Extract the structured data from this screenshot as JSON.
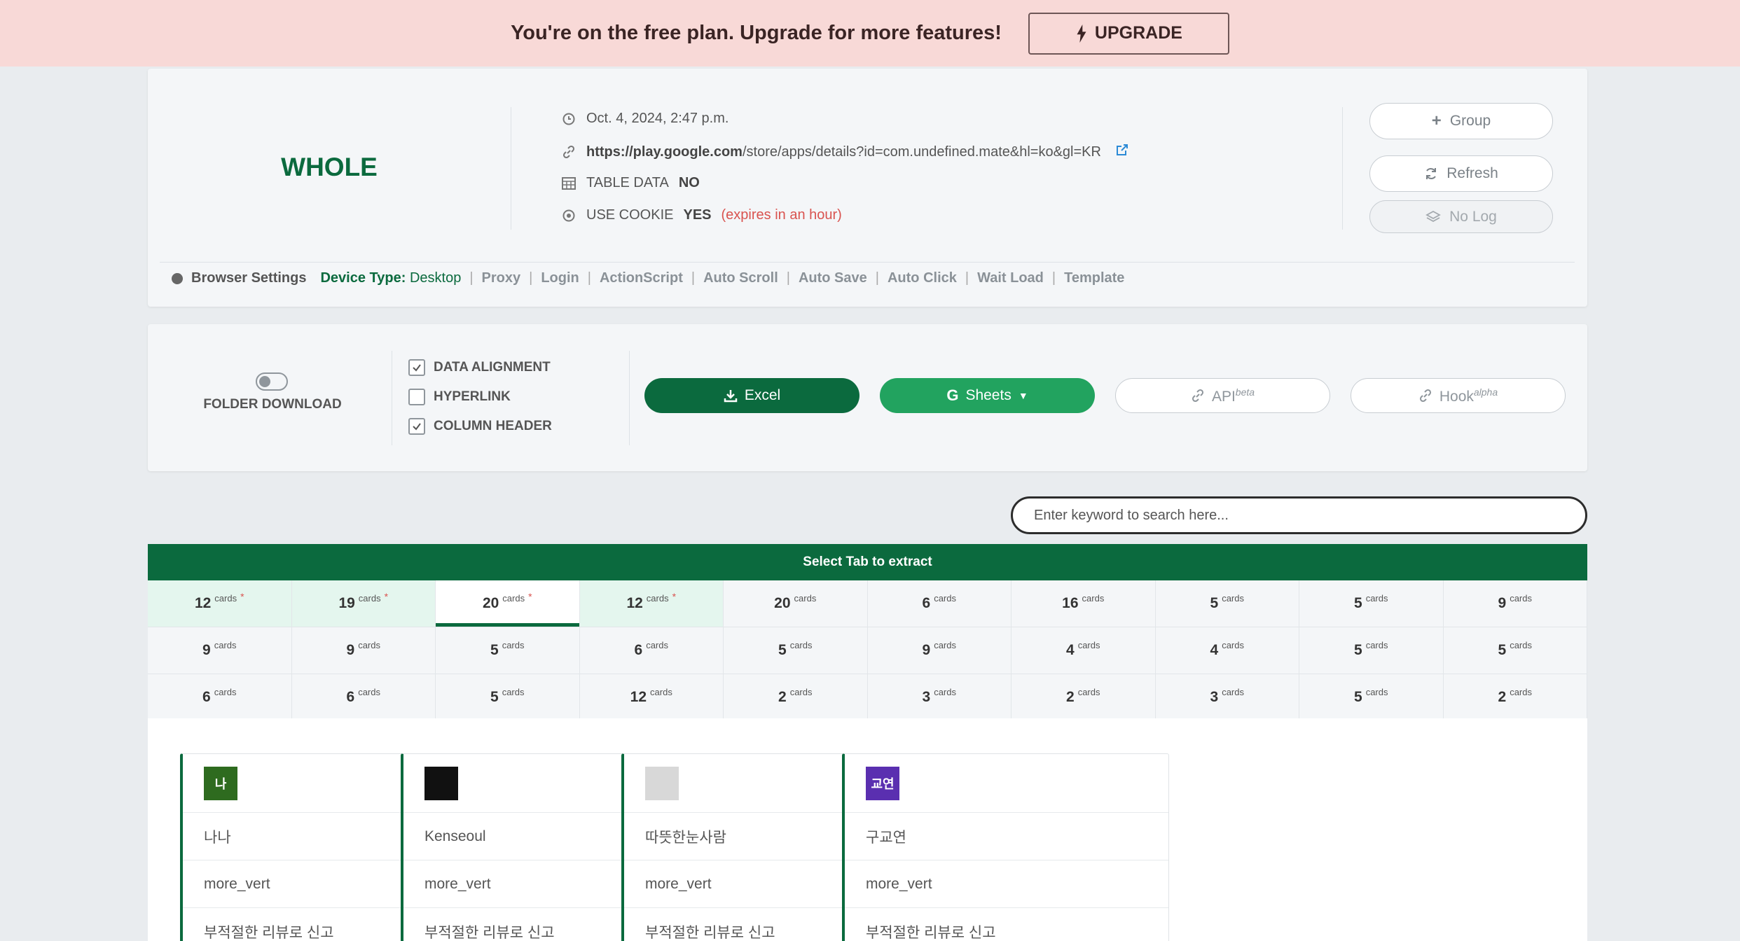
{
  "banner": {
    "text": "You're on the free plan. Upgrade for more features!",
    "button": "UPGRADE"
  },
  "info": {
    "title": "WHOLE",
    "timestamp": "Oct. 4, 2024, 2:47 p.m.",
    "url_host": "https://play.google.com",
    "url_path": "/store/apps/details?id=com.undefined.mate&hl=ko&gl=KR",
    "table_data_label": "TABLE DATA",
    "table_data_value": "NO",
    "use_cookie_label": "USE COOKIE",
    "use_cookie_value": "YES",
    "cookie_expiry": "(expires in an hour)"
  },
  "side_buttons": {
    "group": "Group",
    "refresh": "Refresh",
    "nolog": "No Log"
  },
  "settings": {
    "browser": "Browser Settings",
    "device_label": "Device Type:",
    "device_value": "Desktop",
    "items": [
      "Proxy",
      "Login",
      "ActionScript",
      "Auto Scroll",
      "Auto Save",
      "Auto Click",
      "Wait Load",
      "Template"
    ]
  },
  "export": {
    "folder_download": "FOLDER DOWNLOAD",
    "folder_download_on": false,
    "options": [
      {
        "label": "DATA ALIGNMENT",
        "checked": true
      },
      {
        "label": "HYPERLINK",
        "checked": false
      },
      {
        "label": "COLUMN HEADER",
        "checked": true
      }
    ],
    "excel": "Excel",
    "sheets": "Sheets",
    "api": "API",
    "api_tag": "beta",
    "hook": "Hook",
    "hook_tag": "alpha"
  },
  "search": {
    "placeholder": "Enter keyword to search here..."
  },
  "tabs": {
    "header": "Select Tab to extract",
    "unit": "cards",
    "rows": [
      [
        {
          "n": "12",
          "star": true,
          "hl": true
        },
        {
          "n": "19",
          "star": true,
          "hl": true
        },
        {
          "n": "20",
          "star": true,
          "active": true
        },
        {
          "n": "12",
          "star": true,
          "hl": true
        },
        {
          "n": "20"
        },
        {
          "n": "6"
        },
        {
          "n": "16"
        },
        {
          "n": "5"
        },
        {
          "n": "5"
        },
        {
          "n": "9"
        }
      ],
      [
        {
          "n": "9"
        },
        {
          "n": "9"
        },
        {
          "n": "5"
        },
        {
          "n": "6"
        },
        {
          "n": "5"
        },
        {
          "n": "9"
        },
        {
          "n": "4"
        },
        {
          "n": "4"
        },
        {
          "n": "5"
        },
        {
          "n": "5"
        }
      ],
      [
        {
          "n": "6"
        },
        {
          "n": "6"
        },
        {
          "n": "5"
        },
        {
          "n": "12"
        },
        {
          "n": "2"
        },
        {
          "n": "3"
        },
        {
          "n": "2"
        },
        {
          "n": "3"
        },
        {
          "n": "5"
        },
        {
          "n": "2"
        }
      ]
    ]
  },
  "cards": [
    {
      "avatar_text": "나",
      "avatar_color": "#2e6b1f",
      "name": "나나",
      "menu": "more_vert",
      "report": "부적절한 리뷰로 신고"
    },
    {
      "avatar_text": "",
      "avatar_color": "#111111",
      "name": "Kenseoul",
      "menu": "more_vert",
      "report": "부적절한 리뷰로 신고"
    },
    {
      "avatar_text": "",
      "avatar_color": "#d8d8d8",
      "name": "따뜻한눈사람",
      "menu": "more_vert",
      "report": "부적절한 리뷰로 신고"
    },
    {
      "avatar_text": "교연",
      "avatar_color": "#5a2fb0",
      "name": "구교연",
      "menu": "more_vert",
      "report": "부적절한 리뷰로 신고"
    }
  ]
}
